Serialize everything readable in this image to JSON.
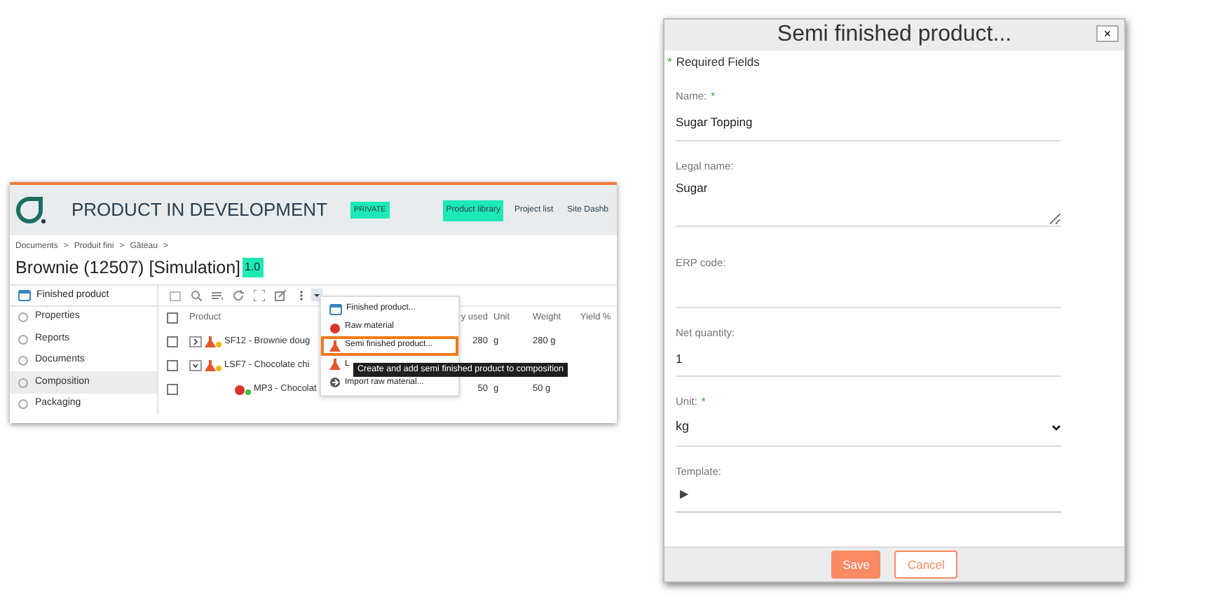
{
  "app": {
    "title": "PRODUCT IN DEVELOPMENT",
    "badge": "PRIVATE",
    "nav": [
      {
        "label": "Product library",
        "selected": true
      },
      {
        "label": "Project list",
        "selected": false
      },
      {
        "label": "Site Dashb",
        "selected": false
      }
    ],
    "breadcrumbs": [
      "Documents",
      ">",
      "Produit fini",
      ">",
      "Gâteau",
      ">"
    ],
    "page_title": "Brownie (12507) [Simulation]",
    "version": "1.0",
    "sidebar": {
      "header": "Finished product",
      "items": [
        {
          "label": "Properties",
          "selected": false
        },
        {
          "label": "Reports",
          "selected": false
        },
        {
          "label": "Documents",
          "selected": false
        },
        {
          "label": "Composition",
          "selected": true
        },
        {
          "label": "Packaging",
          "selected": false
        }
      ]
    },
    "table": {
      "all_checked": false,
      "columns": [
        "Product",
        "y used",
        "Unit",
        "Weight",
        "Yield %"
      ],
      "rows": [
        {
          "checked": false,
          "expanded": false,
          "kind": "semi",
          "cells": [
            "SF12 - Brownie doug",
            "280",
            "g",
            "280 g"
          ]
        },
        {
          "checked": false,
          "expanded": true,
          "kind": "semi",
          "cells": [
            "LSF7 - Chocolate chi"
          ]
        },
        {
          "checked": false,
          "kind": "raw",
          "cells": [
            "MP3 - Chocolat",
            "50",
            "g",
            "50 g"
          ]
        }
      ]
    },
    "menu": [
      {
        "kind": "finished",
        "label": "Finished product...",
        "selected": false
      },
      {
        "kind": "raw",
        "label": "Raw material",
        "selected": false
      },
      {
        "kind": "semi",
        "label": "Semi finished product...",
        "selected": true
      },
      {
        "kind": "semi",
        "label": "L",
        "selected": false
      },
      {
        "kind": "import",
        "label": "Import raw material...",
        "selected": false
      }
    ],
    "tooltip": "Create and add semi finished product to composition"
  },
  "dialog": {
    "title": "Semi finished product...",
    "close": "×",
    "required_note": "Required Fields",
    "required_mark": "*",
    "fields": [
      {
        "kind": "input",
        "label": "Name:",
        "required": true,
        "value": "Sugar Topping"
      },
      {
        "kind": "textarea",
        "label": "Legal name:",
        "required": false,
        "value": "Sugar"
      },
      {
        "kind": "input",
        "label": "ERP code:",
        "required": false
      },
      {
        "kind": "input",
        "label": "Net quantity:",
        "required": false,
        "value": "1"
      },
      {
        "kind": "select",
        "label": "Unit:",
        "required": true,
        "value": "kg"
      },
      {
        "kind": "tree",
        "label": "Template:",
        "required": false,
        "value": "▶"
      }
    ],
    "buttons": [
      {
        "label": "Save",
        "kind": "primary"
      },
      {
        "label": "Cancel",
        "kind": "secondary"
      }
    ]
  }
}
